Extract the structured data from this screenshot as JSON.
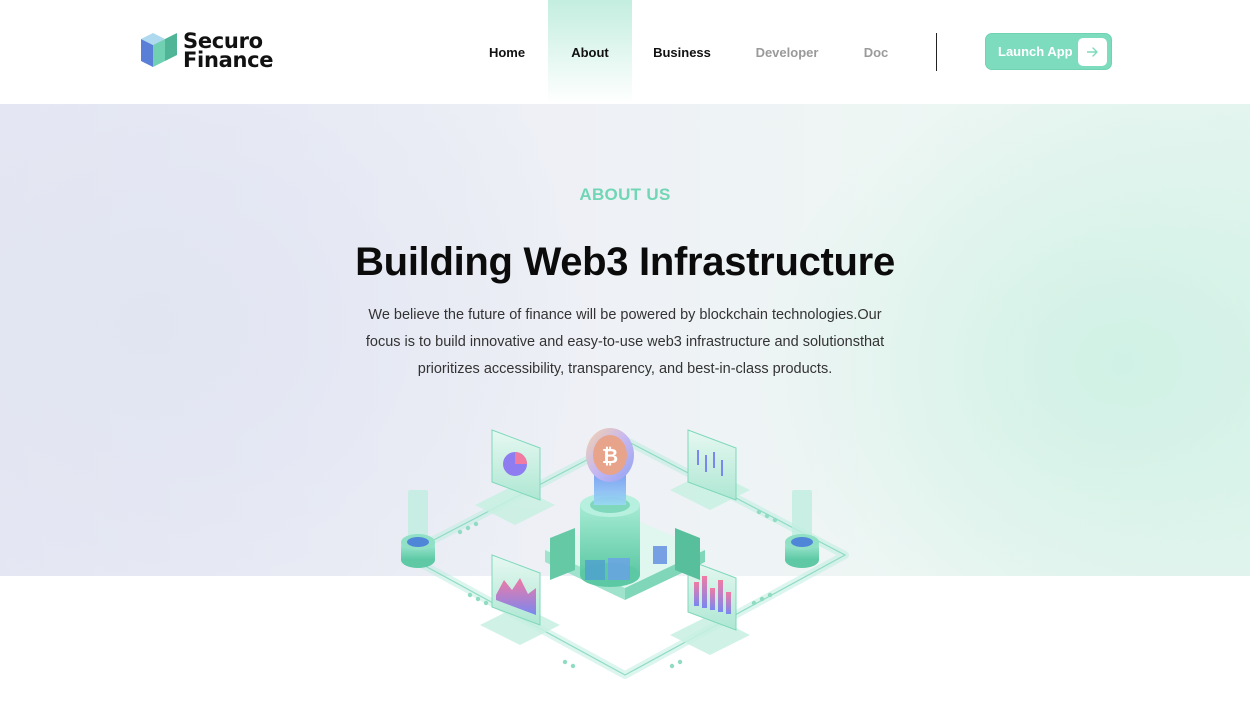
{
  "brand": {
    "line1": "Securo",
    "line2": "Finance",
    "accent": "#70d6b4"
  },
  "nav": {
    "items": [
      {
        "label": "Home",
        "state": "default"
      },
      {
        "label": "About",
        "state": "active"
      },
      {
        "label": "Business",
        "state": "default"
      },
      {
        "label": "Developer",
        "state": "muted"
      },
      {
        "label": "Doc",
        "state": "muted"
      }
    ],
    "cta": {
      "label": "Launch App",
      "icon": "arrow-right-icon"
    }
  },
  "hero": {
    "kicker": "ABOUT US",
    "title": "Building Web3 Infrastructure",
    "desc_lines": [
      "We believe the future of finance will be powered by blockchain technologies.Our",
      "focus is to build innovative and easy-to-use web3 infrastructure and solutionsthat",
      "prioritizes accessibility, transparency, and best-in-class products."
    ],
    "illustration": "isometric-blockchain-infrastructure-illustration"
  }
}
